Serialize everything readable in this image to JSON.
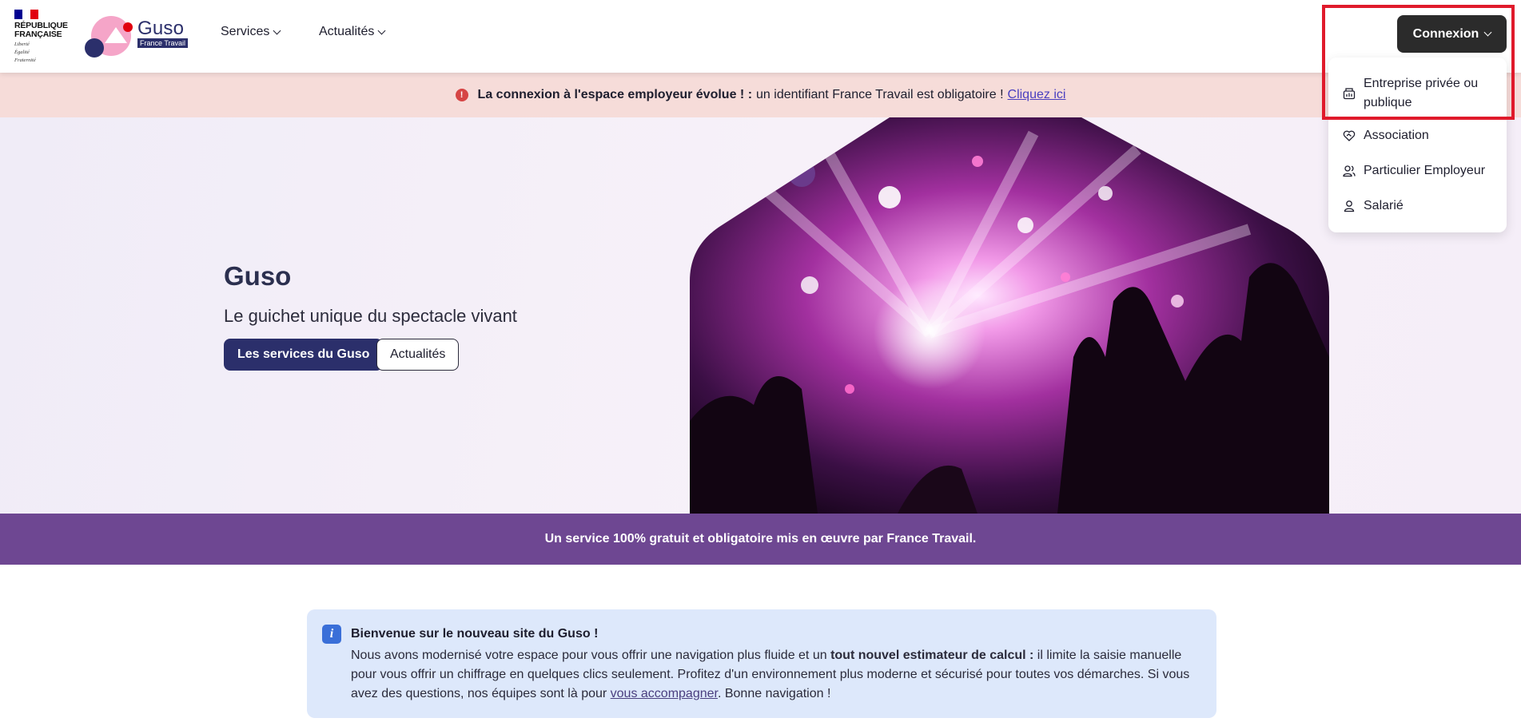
{
  "header": {
    "rf_logo": {
      "name_line1": "RÉPUBLIQUE",
      "name_line2": "FRANÇAISE",
      "motto_line1": "Liberté",
      "motto_line2": "Égalité",
      "motto_line3": "Fraternité"
    },
    "guso_logo": {
      "word": "Guso",
      "subtitle": "France Travail"
    },
    "nav": [
      {
        "label": "Services",
        "icon": "chevron-down-icon"
      },
      {
        "label": "Actualités",
        "icon": "chevron-down-icon"
      }
    ],
    "connexion_label": "Connexion"
  },
  "alert": {
    "bold": "La connexion à l'espace employeur évolue ! :",
    "text": "un identifiant France Travail est obligatoire !",
    "link": "Cliquez ici"
  },
  "hero": {
    "title": "Guso",
    "subtitle": "Le guichet unique du spectacle vivant",
    "primary_button": "Les services du Guso",
    "secondary_button": "Actualités"
  },
  "band": {
    "text": "Un service 100% gratuit et obligatoire mis en œuvre par France Travail."
  },
  "info": {
    "title": "Bienvenue sur le nouveau site du Guso !",
    "body_start": "Nous avons modernisé votre espace pour vous offrir une navigation plus fluide et un ",
    "body_bold": "tout nouvel estimateur de calcul :",
    "body_middle": " il limite la saisie manuelle pour vous offrir un chiffrage en quelques clics seulement. Profitez d'un environnement plus moderne et sécurisé pour toutes vos démarches. Si vous avez des questions, nos équipes sont là pour ",
    "body_link": "vous accompagner",
    "body_end": ". Bonne navigation !"
  },
  "dropdown": {
    "items": [
      {
        "label_line1": "Entreprise privée ou",
        "label_line2": "publique",
        "icon": "building-chart-icon"
      },
      {
        "label": "Association",
        "icon": "handshake-heart-icon"
      },
      {
        "label": "Particulier Employeur",
        "icon": "user-group-icon"
      },
      {
        "label": "Salarié",
        "icon": "user-icon"
      }
    ]
  },
  "colors": {
    "navy": "#2b2f6b",
    "alert_bg": "#f6dcd9",
    "band_purple": "#6e4792",
    "info_bg": "#dde8fb",
    "highlight_red": "#e01a2b",
    "connexion_bg": "#2b2b2b"
  }
}
